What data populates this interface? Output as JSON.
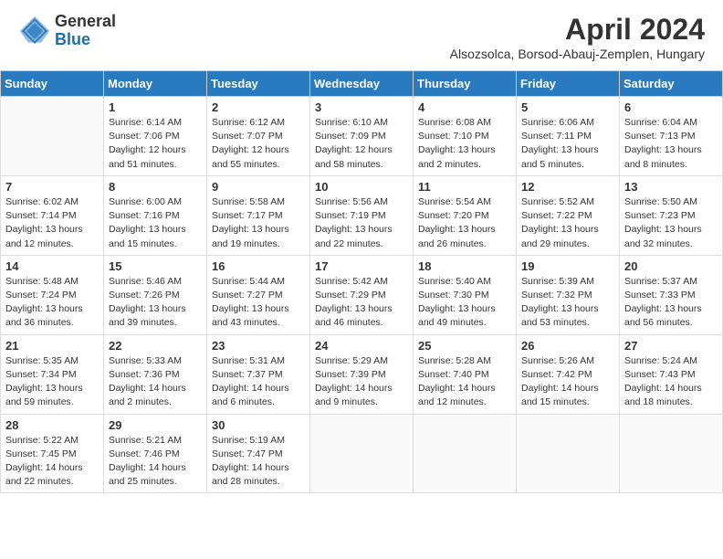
{
  "header": {
    "logo_general": "General",
    "logo_blue": "Blue",
    "title": "April 2024",
    "subtitle": "Alsozsolca, Borsod-Abauj-Zemplen, Hungary"
  },
  "weekdays": [
    "Sunday",
    "Monday",
    "Tuesday",
    "Wednesday",
    "Thursday",
    "Friday",
    "Saturday"
  ],
  "weeks": [
    [
      {
        "num": "",
        "info": ""
      },
      {
        "num": "1",
        "info": "Sunrise: 6:14 AM\nSunset: 7:06 PM\nDaylight: 12 hours\nand 51 minutes."
      },
      {
        "num": "2",
        "info": "Sunrise: 6:12 AM\nSunset: 7:07 PM\nDaylight: 12 hours\nand 55 minutes."
      },
      {
        "num": "3",
        "info": "Sunrise: 6:10 AM\nSunset: 7:09 PM\nDaylight: 12 hours\nand 58 minutes."
      },
      {
        "num": "4",
        "info": "Sunrise: 6:08 AM\nSunset: 7:10 PM\nDaylight: 13 hours\nand 2 minutes."
      },
      {
        "num": "5",
        "info": "Sunrise: 6:06 AM\nSunset: 7:11 PM\nDaylight: 13 hours\nand 5 minutes."
      },
      {
        "num": "6",
        "info": "Sunrise: 6:04 AM\nSunset: 7:13 PM\nDaylight: 13 hours\nand 8 minutes."
      }
    ],
    [
      {
        "num": "7",
        "info": "Sunrise: 6:02 AM\nSunset: 7:14 PM\nDaylight: 13 hours\nand 12 minutes."
      },
      {
        "num": "8",
        "info": "Sunrise: 6:00 AM\nSunset: 7:16 PM\nDaylight: 13 hours\nand 15 minutes."
      },
      {
        "num": "9",
        "info": "Sunrise: 5:58 AM\nSunset: 7:17 PM\nDaylight: 13 hours\nand 19 minutes."
      },
      {
        "num": "10",
        "info": "Sunrise: 5:56 AM\nSunset: 7:19 PM\nDaylight: 13 hours\nand 22 minutes."
      },
      {
        "num": "11",
        "info": "Sunrise: 5:54 AM\nSunset: 7:20 PM\nDaylight: 13 hours\nand 26 minutes."
      },
      {
        "num": "12",
        "info": "Sunrise: 5:52 AM\nSunset: 7:22 PM\nDaylight: 13 hours\nand 29 minutes."
      },
      {
        "num": "13",
        "info": "Sunrise: 5:50 AM\nSunset: 7:23 PM\nDaylight: 13 hours\nand 32 minutes."
      }
    ],
    [
      {
        "num": "14",
        "info": "Sunrise: 5:48 AM\nSunset: 7:24 PM\nDaylight: 13 hours\nand 36 minutes."
      },
      {
        "num": "15",
        "info": "Sunrise: 5:46 AM\nSunset: 7:26 PM\nDaylight: 13 hours\nand 39 minutes."
      },
      {
        "num": "16",
        "info": "Sunrise: 5:44 AM\nSunset: 7:27 PM\nDaylight: 13 hours\nand 43 minutes."
      },
      {
        "num": "17",
        "info": "Sunrise: 5:42 AM\nSunset: 7:29 PM\nDaylight: 13 hours\nand 46 minutes."
      },
      {
        "num": "18",
        "info": "Sunrise: 5:40 AM\nSunset: 7:30 PM\nDaylight: 13 hours\nand 49 minutes."
      },
      {
        "num": "19",
        "info": "Sunrise: 5:39 AM\nSunset: 7:32 PM\nDaylight: 13 hours\nand 53 minutes."
      },
      {
        "num": "20",
        "info": "Sunrise: 5:37 AM\nSunset: 7:33 PM\nDaylight: 13 hours\nand 56 minutes."
      }
    ],
    [
      {
        "num": "21",
        "info": "Sunrise: 5:35 AM\nSunset: 7:34 PM\nDaylight: 13 hours\nand 59 minutes."
      },
      {
        "num": "22",
        "info": "Sunrise: 5:33 AM\nSunset: 7:36 PM\nDaylight: 14 hours\nand 2 minutes."
      },
      {
        "num": "23",
        "info": "Sunrise: 5:31 AM\nSunset: 7:37 PM\nDaylight: 14 hours\nand 6 minutes."
      },
      {
        "num": "24",
        "info": "Sunrise: 5:29 AM\nSunset: 7:39 PM\nDaylight: 14 hours\nand 9 minutes."
      },
      {
        "num": "25",
        "info": "Sunrise: 5:28 AM\nSunset: 7:40 PM\nDaylight: 14 hours\nand 12 minutes."
      },
      {
        "num": "26",
        "info": "Sunrise: 5:26 AM\nSunset: 7:42 PM\nDaylight: 14 hours\nand 15 minutes."
      },
      {
        "num": "27",
        "info": "Sunrise: 5:24 AM\nSunset: 7:43 PM\nDaylight: 14 hours\nand 18 minutes."
      }
    ],
    [
      {
        "num": "28",
        "info": "Sunrise: 5:22 AM\nSunset: 7:45 PM\nDaylight: 14 hours\nand 22 minutes."
      },
      {
        "num": "29",
        "info": "Sunrise: 5:21 AM\nSunset: 7:46 PM\nDaylight: 14 hours\nand 25 minutes."
      },
      {
        "num": "30",
        "info": "Sunrise: 5:19 AM\nSunset: 7:47 PM\nDaylight: 14 hours\nand 28 minutes."
      },
      {
        "num": "",
        "info": ""
      },
      {
        "num": "",
        "info": ""
      },
      {
        "num": "",
        "info": ""
      },
      {
        "num": "",
        "info": ""
      }
    ]
  ]
}
